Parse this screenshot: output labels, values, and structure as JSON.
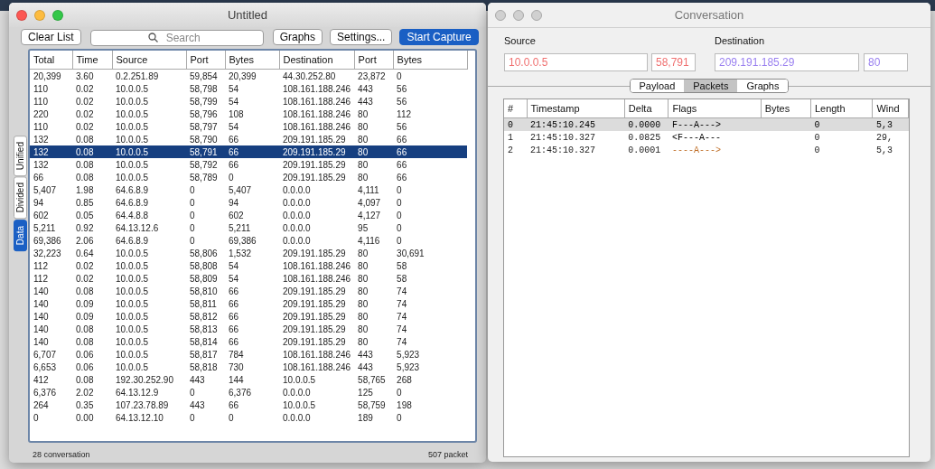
{
  "main_window": {
    "title": "Untitled",
    "active": true,
    "toolbar": {
      "clear_button": "Clear List",
      "search": {
        "placeholder": "Search"
      },
      "graphs_button": "Graphs",
      "settings_button": "Settings...",
      "capture_button": "Start Capture"
    },
    "side_tabs": [
      {
        "label": "Unified",
        "selected": false
      },
      {
        "label": "Divided",
        "selected": false
      },
      {
        "label": "Data",
        "selected": true
      }
    ],
    "table": {
      "columns": [
        "Total",
        "Time",
        "Source",
        "Port",
        "Bytes",
        "Destination",
        "Port",
        "Bytes"
      ],
      "rows": [
        {
          "cells": [
            "20,399",
            "3.60",
            "0.2.251.89",
            "59,854",
            "20,399",
            "44.30.252.80",
            "23,872",
            "0"
          ],
          "selected": false
        },
        {
          "cells": [
            "110",
            "0.02",
            "10.0.0.5",
            "58,798",
            "54",
            "108.161.188.246",
            "443",
            "56"
          ],
          "selected": false
        },
        {
          "cells": [
            "110",
            "0.02",
            "10.0.0.5",
            "58,799",
            "54",
            "108.161.188.246",
            "443",
            "56"
          ],
          "selected": false
        },
        {
          "cells": [
            "220",
            "0.02",
            "10.0.0.5",
            "58,796",
            "108",
            "108.161.188.246",
            "80",
            "112"
          ],
          "selected": false
        },
        {
          "cells": [
            "110",
            "0.02",
            "10.0.0.5",
            "58,797",
            "54",
            "108.161.188.246",
            "80",
            "56"
          ],
          "selected": false
        },
        {
          "cells": [
            "132",
            "0.08",
            "10.0.0.5",
            "58,790",
            "66",
            "209.191.185.29",
            "80",
            "66"
          ],
          "selected": false
        },
        {
          "cells": [
            "132",
            "0.08",
            "10.0.0.5",
            "58,791",
            "66",
            "209.191.185.29",
            "80",
            "66"
          ],
          "selected": true
        },
        {
          "cells": [
            "132",
            "0.08",
            "10.0.0.5",
            "58,792",
            "66",
            "209.191.185.29",
            "80",
            "66"
          ],
          "selected": false
        },
        {
          "cells": [
            "66",
            "0.08",
            "10.0.0.5",
            "58,789",
            "0",
            "209.191.185.29",
            "80",
            "66"
          ],
          "selected": false
        },
        {
          "cells": [
            "5,407",
            "1.98",
            "64.6.8.9",
            "0",
            "5,407",
            "0.0.0.0",
            "4,111",
            "0"
          ],
          "selected": false
        },
        {
          "cells": [
            "94",
            "0.85",
            "64.6.8.9",
            "0",
            "94",
            "0.0.0.0",
            "4,097",
            "0"
          ],
          "selected": false
        },
        {
          "cells": [
            "602",
            "0.05",
            "64.4.8.8",
            "0",
            "602",
            "0.0.0.0",
            "4,127",
            "0"
          ],
          "selected": false
        },
        {
          "cells": [
            "5,211",
            "0.92",
            "64.13.12.6",
            "0",
            "5,211",
            "0.0.0.0",
            "95",
            "0"
          ],
          "selected": false
        },
        {
          "cells": [
            "69,386",
            "2.06",
            "64.6.8.9",
            "0",
            "69,386",
            "0.0.0.0",
            "4,116",
            "0"
          ],
          "selected": false
        },
        {
          "cells": [
            "32,223",
            "0.64",
            "10.0.0.5",
            "58,806",
            "1,532",
            "209.191.185.29",
            "80",
            "30,691"
          ],
          "selected": false
        },
        {
          "cells": [
            "112",
            "0.02",
            "10.0.0.5",
            "58,808",
            "54",
            "108.161.188.246",
            "80",
            "58"
          ],
          "selected": false
        },
        {
          "cells": [
            "112",
            "0.02",
            "10.0.0.5",
            "58,809",
            "54",
            "108.161.188.246",
            "80",
            "58"
          ],
          "selected": false
        },
        {
          "cells": [
            "140",
            "0.08",
            "10.0.0.5",
            "58,810",
            "66",
            "209.191.185.29",
            "80",
            "74"
          ],
          "selected": false
        },
        {
          "cells": [
            "140",
            "0.09",
            "10.0.0.5",
            "58,811",
            "66",
            "209.191.185.29",
            "80",
            "74"
          ],
          "selected": false
        },
        {
          "cells": [
            "140",
            "0.09",
            "10.0.0.5",
            "58,812",
            "66",
            "209.191.185.29",
            "80",
            "74"
          ],
          "selected": false
        },
        {
          "cells": [
            "140",
            "0.08",
            "10.0.0.5",
            "58,813",
            "66",
            "209.191.185.29",
            "80",
            "74"
          ],
          "selected": false
        },
        {
          "cells": [
            "140",
            "0.08",
            "10.0.0.5",
            "58,814",
            "66",
            "209.191.185.29",
            "80",
            "74"
          ],
          "selected": false
        },
        {
          "cells": [
            "6,707",
            "0.06",
            "10.0.0.5",
            "58,817",
            "784",
            "108.161.188.246",
            "443",
            "5,923"
          ],
          "selected": false
        },
        {
          "cells": [
            "6,653",
            "0.06",
            "10.0.0.5",
            "58,818",
            "730",
            "108.161.188.246",
            "443",
            "5,923"
          ],
          "selected": false
        },
        {
          "cells": [
            "412",
            "0.08",
            "192.30.252.90",
            "443",
            "144",
            "10.0.0.5",
            "58,765",
            "268"
          ],
          "selected": false
        },
        {
          "cells": [
            "6,376",
            "2.02",
            "64.13.12.9",
            "0",
            "6,376",
            "0.0.0.0",
            "125",
            "0"
          ],
          "selected": false
        },
        {
          "cells": [
            "264",
            "0.35",
            "107.23.78.89",
            "443",
            "66",
            "10.0.0.5",
            "58,759",
            "198"
          ],
          "selected": false
        },
        {
          "cells": [
            "0",
            "0.00",
            "64.13.12.10",
            "0",
            "0",
            "0.0.0.0",
            "189",
            "0"
          ],
          "selected": false
        }
      ]
    },
    "status_bar": {
      "left": "28 conversation",
      "right": "507 packet"
    }
  },
  "conversation_window": {
    "title": "Conversation",
    "active": false,
    "source": {
      "label": "Source",
      "address": "10.0.0.5",
      "port": "58,791"
    },
    "destination": {
      "label": "Destination",
      "address": "209.191.185.29",
      "port": "80"
    },
    "tabs": [
      {
        "label": "Payload",
        "selected": false
      },
      {
        "label": "Packets",
        "selected": true
      },
      {
        "label": "Graphs",
        "selected": false
      }
    ],
    "table": {
      "columns": [
        "#",
        "Timestamp",
        "Delta",
        "Flags",
        "Bytes",
        "Length",
        "Wind"
      ],
      "rows": [
        {
          "cells": [
            "0",
            "21:45:10.245",
            "0.0000",
            "F---A--->",
            "",
            "0",
            "5,3"
          ],
          "selected": true,
          "color": "#000000"
        },
        {
          "cells": [
            "1",
            "21:45:10.327",
            "0.0825",
            "<F---A---",
            "",
            "0",
            "29,"
          ],
          "selected": false,
          "color": "#000000"
        },
        {
          "cells": [
            "2",
            "21:45:10.327",
            "0.0001",
            "----A--->",
            "",
            "0",
            "5,3"
          ],
          "selected": false,
          "color": "#c0702a"
        }
      ]
    }
  }
}
